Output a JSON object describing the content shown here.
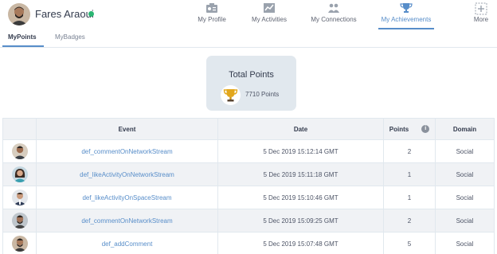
{
  "user": {
    "name": "Fares Araoui",
    "status_color": "#2bb673"
  },
  "nav": {
    "items": [
      {
        "label": "My Profile",
        "icon": "profile-card-icon",
        "active": false
      },
      {
        "label": "My Activities",
        "icon": "activity-chart-icon",
        "active": false
      },
      {
        "label": "My Connections",
        "icon": "connections-icon",
        "active": false
      },
      {
        "label": "My Achievements",
        "icon": "trophy-icon",
        "active": true
      },
      {
        "label": "More",
        "icon": "plus-box-icon",
        "active": false
      }
    ]
  },
  "subtabs": [
    {
      "label": "MyPoints",
      "active": true
    },
    {
      "label": "MyBadges",
      "active": false
    }
  ],
  "total": {
    "title": "Total Points",
    "value": "7710 Points"
  },
  "table": {
    "headers": {
      "event": "Event",
      "date": "Date",
      "points": "Points",
      "domain": "Domain"
    },
    "rows": [
      {
        "event": "def_commentOnNetworkStream",
        "date": "5 Dec 2019 15:12:14 GMT",
        "points": "2",
        "domain": "Social"
      },
      {
        "event": "def_likeActivityOnNetworkStream",
        "date": "5 Dec 2019 15:11:18 GMT",
        "points": "1",
        "domain": "Social"
      },
      {
        "event": "def_likeActivityOnSpaceStream",
        "date": "5 Dec 2019 15:10:46 GMT",
        "points": "1",
        "domain": "Social"
      },
      {
        "event": "def_commentOnNetworkStream",
        "date": "5 Dec 2019 15:09:25 GMT",
        "points": "2",
        "domain": "Social"
      },
      {
        "event": "def_addComment",
        "date": "5 Dec 2019 15:07:48 GMT",
        "points": "5",
        "domain": "Social"
      }
    ]
  },
  "colors": {
    "accent": "#578dc9",
    "card_bg": "#e1e8ee",
    "row_alt": "#f0f2f5"
  }
}
